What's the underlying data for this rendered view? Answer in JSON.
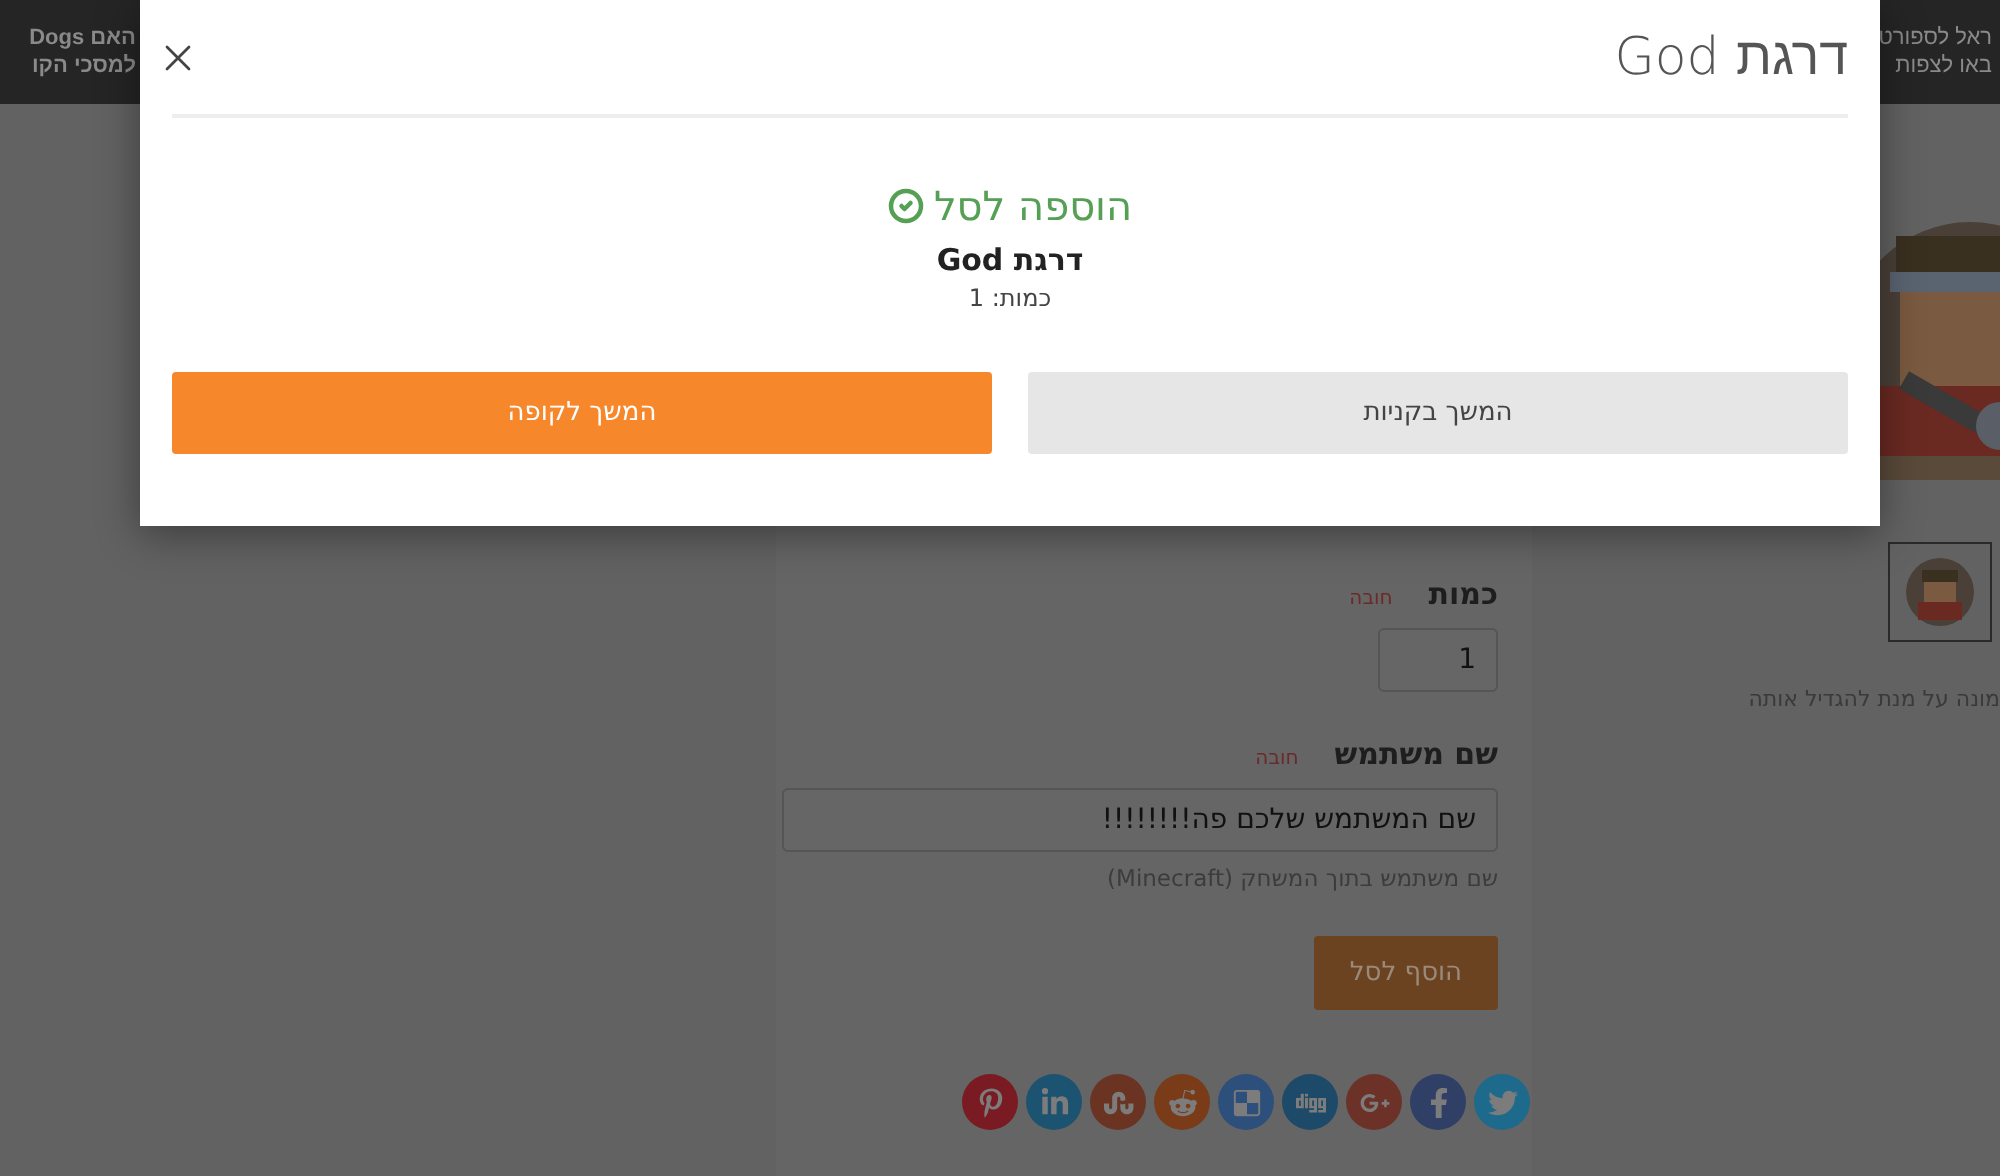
{
  "header": {
    "left_lines": [
      "האם Dogs",
      "למסכי הקו"
    ],
    "right_lines": [
      "ראל לספורט",
      "באו לצפות"
    ]
  },
  "product": {
    "image_hint": "מונה על מנת להגדיל אותה"
  },
  "form": {
    "fields": [
      {
        "kind": "short",
        "label": "כמות",
        "required": "חובה",
        "value": "1"
      },
      {
        "kind": "wide",
        "label": "שם משתמש",
        "required": "חובה",
        "value": "שם המשתמש שלכם פה!!!!!!!!",
        "help": "שם משתמש בתוך המשחק (Minecraft)"
      }
    ],
    "submit": "הוסף לסל"
  },
  "share": [
    {
      "kind": "twitter",
      "color": "#1d6a8c"
    },
    {
      "kind": "facebook",
      "color": "#2f3f66"
    },
    {
      "kind": "googleplus",
      "color": "#6c3127"
    },
    {
      "kind": "digg",
      "color": "#1d4a68"
    },
    {
      "kind": "delicious",
      "color": "#2c4f7c"
    },
    {
      "kind": "reddit",
      "color": "#7a3b18"
    },
    {
      "kind": "stumbleupon",
      "color": "#6a3322"
    },
    {
      "kind": "linkedin",
      "color": "#1b5370"
    },
    {
      "kind": "pinterest",
      "color": "#7a1a22"
    }
  ],
  "modal": {
    "title": "דרגת God",
    "notice": "הוספה לסל",
    "item": "דרגת God",
    "quantity": "כמות: 1",
    "buttons": [
      {
        "kind": "secondary",
        "label": "המשך בקניות"
      },
      {
        "kind": "primary",
        "label": "המשך לקופה"
      }
    ]
  }
}
